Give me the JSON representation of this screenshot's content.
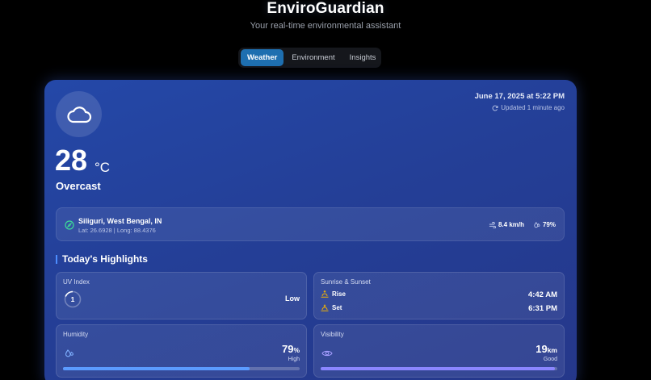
{
  "app": {
    "title": "EnviroGuardian",
    "subtitle": "Your real-time environmental assistant"
  },
  "tabs": [
    {
      "label": "Weather",
      "active": true
    },
    {
      "label": "Environment",
      "active": false
    },
    {
      "label": "Insights",
      "active": false
    }
  ],
  "weather": {
    "icon": "cloud-icon",
    "temperature": "28",
    "unit": "°C",
    "condition": "Overcast",
    "datetime": "June 17, 2025 at 5:22 PM",
    "updated": "Updated 1 minute ago"
  },
  "location": {
    "name": "Siliguri, West Bengal, IN",
    "coords": "Lat: 26.6928 | Long: 88.4376",
    "wind": "8.4 km/h",
    "humidity": "79%"
  },
  "highlights": {
    "heading": "Today's Highlights",
    "uv": {
      "title": "UV Index",
      "value": "1",
      "level": "Low"
    },
    "sun": {
      "title": "Sunrise & Sunset",
      "rise_label": "Rise",
      "rise_time": "4:42 AM",
      "set_label": "Set",
      "set_time": "6:31 PM"
    },
    "humidity": {
      "title": "Humidity",
      "value": "79",
      "unit": "%",
      "status": "High",
      "level": 0.79
    },
    "visibility": {
      "title": "Visibility",
      "value": "19",
      "unit": "km",
      "status": "Good",
      "level": 0.99
    }
  },
  "colors": {
    "accent": "#1e6fb0",
    "card": "#243f97",
    "humidity_bar": "#5b9bff",
    "visibility_bar": "#8b86ff"
  }
}
